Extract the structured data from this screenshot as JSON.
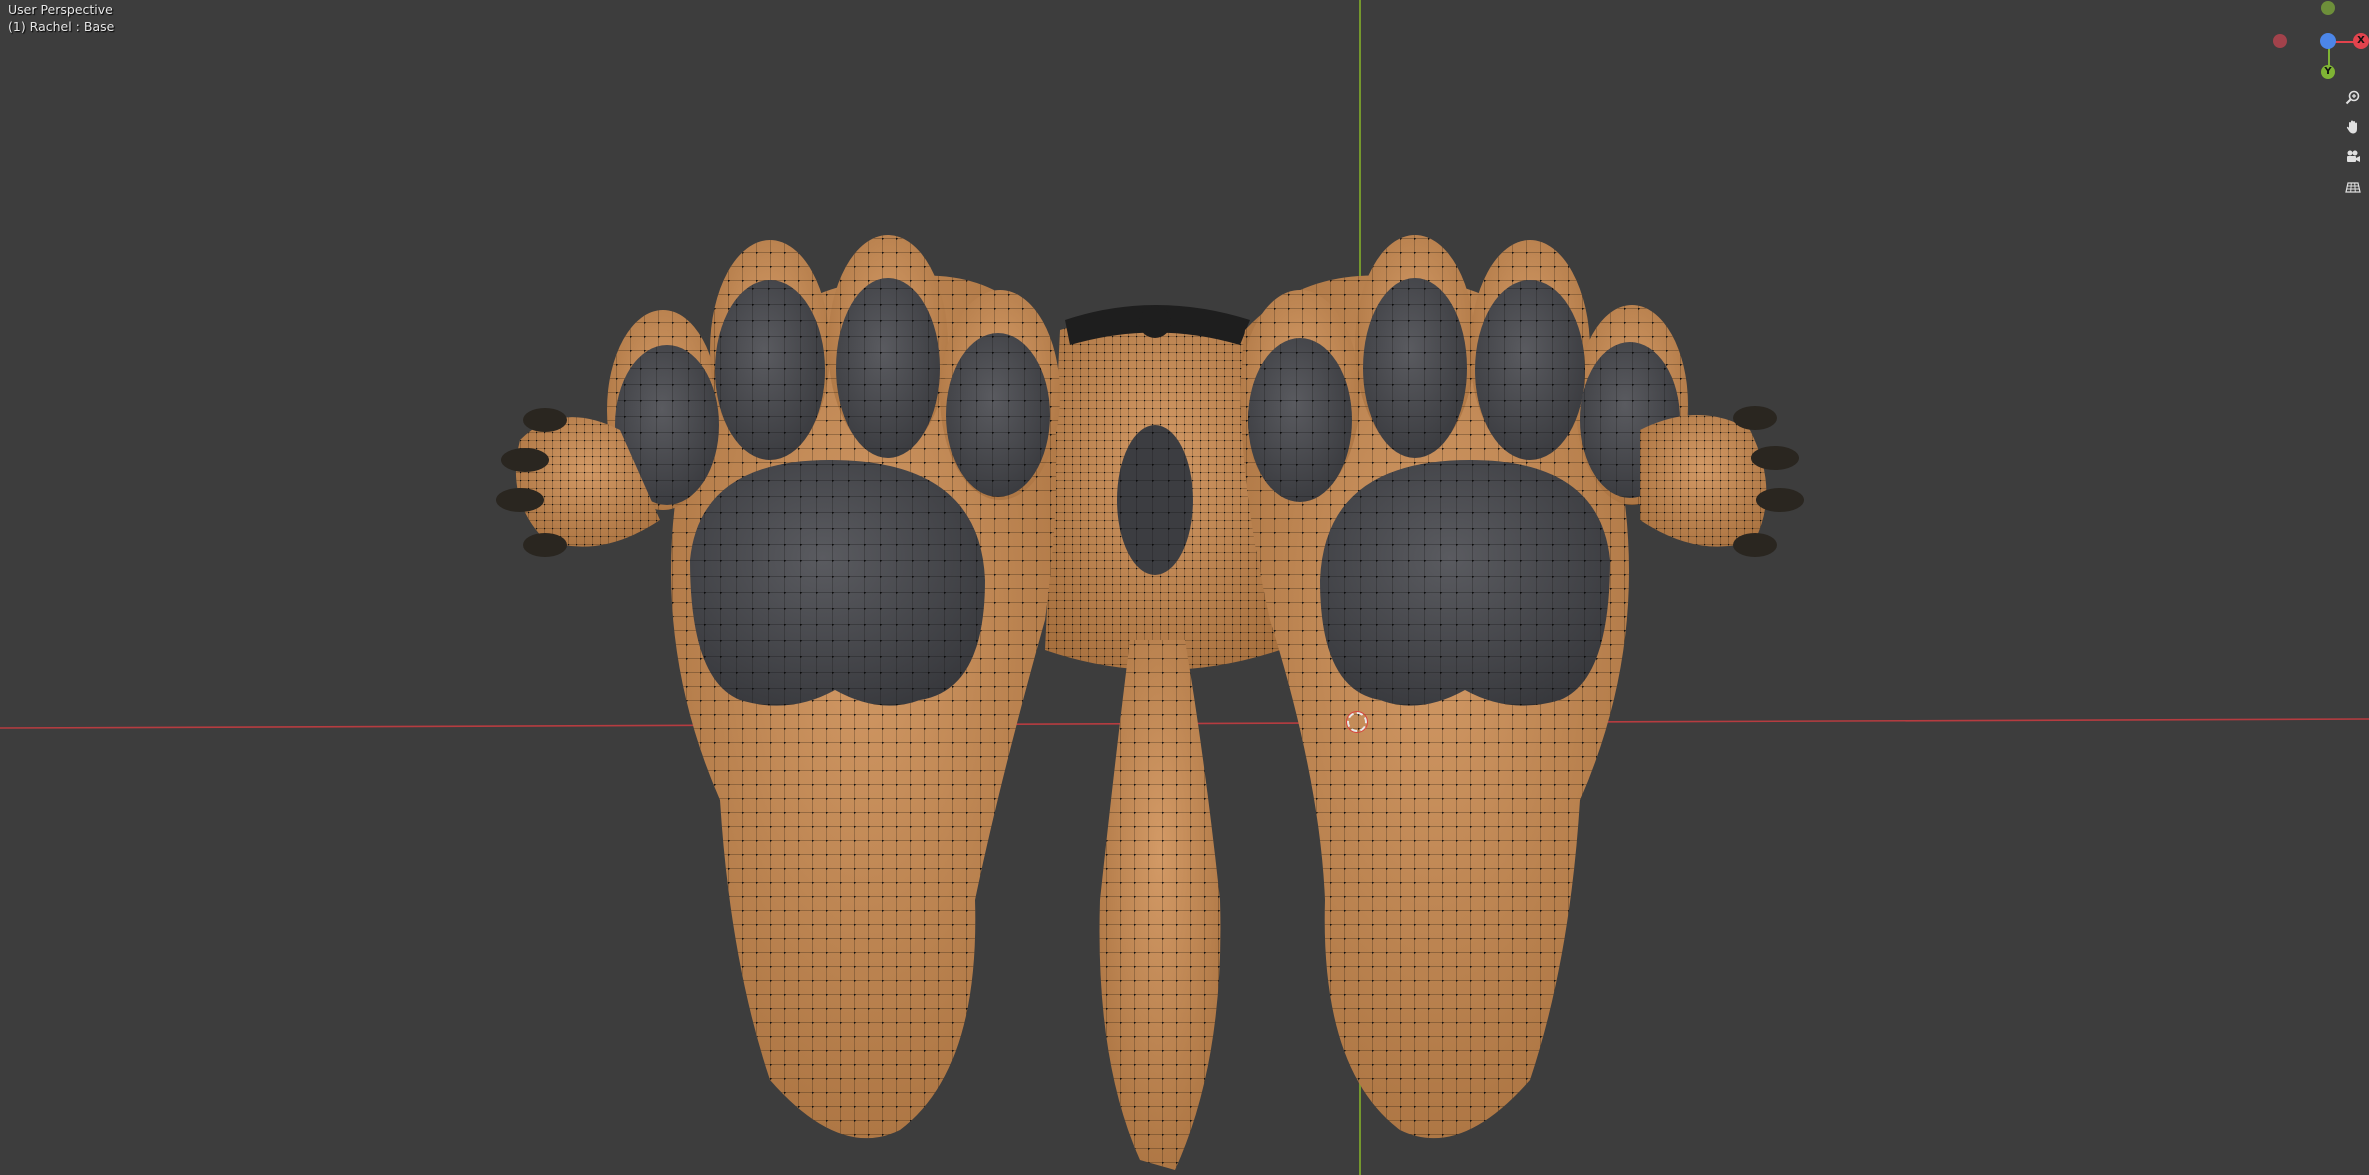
{
  "viewport": {
    "view_name": "User Perspective",
    "object_info": "(1) Rachel : Base"
  },
  "gizmo": {
    "x_label": "X",
    "y_label": "Y",
    "x_color": "#e2434d",
    "y_color": "#7fb434",
    "z_color": "#4c86e8",
    "neg_x_color": "#b4434d"
  },
  "nav_buttons": [
    {
      "icon": "zoom-icon"
    },
    {
      "icon": "hand-pan-icon"
    },
    {
      "icon": "camera-icon"
    },
    {
      "icon": "ortho-grid-icon"
    }
  ],
  "colors": {
    "background": "#3d3d3d",
    "skin": "#c58a57",
    "pad": "#4a4b4f",
    "wire": "#1a1208",
    "x_axis": "#b63c40",
    "y_axis": "#7fa82a"
  }
}
